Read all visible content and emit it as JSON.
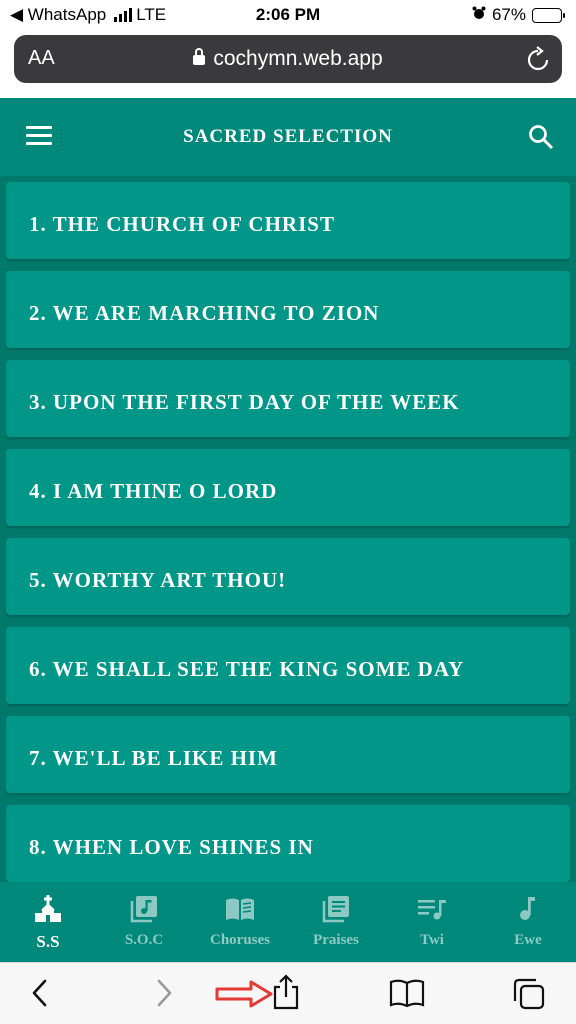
{
  "status_bar": {
    "back_app": "WhatsApp",
    "network": "LTE",
    "time": "2:06 PM",
    "battery_percent": "67%",
    "battery_level": 0.67
  },
  "browser": {
    "text_size_label": "AA",
    "url": "cochymn.web.app"
  },
  "header": {
    "title": "SACRED SELECTION"
  },
  "songs": [
    "1. THE CHURCH OF CHRIST",
    "2. WE ARE MARCHING TO ZION",
    "3. UPON THE FIRST DAY OF THE WEEK",
    "4. I AM THINE O LORD",
    "5. WORTHY ART THOU!",
    "6. WE SHALL SEE THE KING SOME DAY",
    "7. WE'LL BE LIKE HIM",
    "8. WHEN LOVE SHINES IN"
  ],
  "bottom_nav": {
    "tabs": [
      {
        "label": "S.S",
        "icon": "church-icon",
        "active": true
      },
      {
        "label": "S.O.C",
        "icon": "music-library-icon",
        "active": false
      },
      {
        "label": "Choruses",
        "icon": "open-book-icon",
        "active": false
      },
      {
        "label": "Praises",
        "icon": "library-books-icon",
        "active": false
      },
      {
        "label": "Twi",
        "icon": "queue-music-icon",
        "active": false
      },
      {
        "label": "Ewe",
        "icon": "music-note-icon",
        "active": false
      }
    ]
  },
  "colors": {
    "primary": "#009688",
    "header": "#00897b",
    "list_background": "#00796b",
    "annotation_arrow": "#e53935"
  }
}
